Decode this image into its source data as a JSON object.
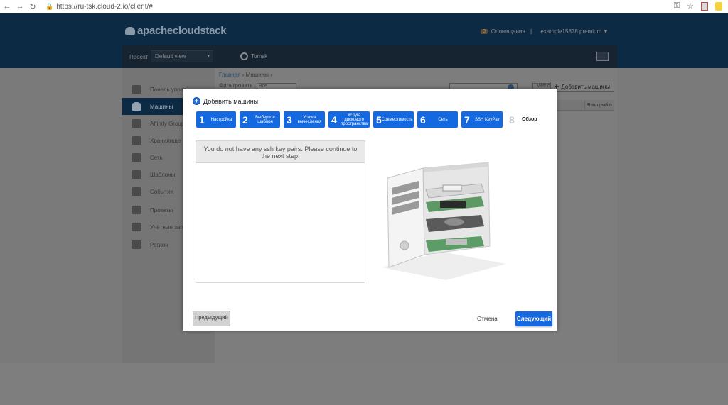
{
  "browser": {
    "back_icon": "arrow-left-icon",
    "forward_icon": "arrow-right-icon",
    "reload_icon": "reload-icon",
    "lock_icon": "lock-icon",
    "url": "https://ru-tsk.cloud-2.io/client/#",
    "key_icon": "key-icon",
    "star_icon": "star-icon"
  },
  "header": {
    "logo": "apachecloudstack",
    "notifications_count": "0",
    "notifications_label": "Оповещения",
    "separator": "|",
    "user_label": "example15878 premium",
    "chevron": "▼"
  },
  "subbar": {
    "project_label": "Проект",
    "project_value": "Default view",
    "project_chevron": "▾",
    "zone": "Tomsk"
  },
  "sidebar": {
    "items": [
      {
        "label": "Панель управ",
        "icon": "dashboard-icon"
      },
      {
        "label": "Машины",
        "icon": "cloud-icon"
      },
      {
        "label": "Affinity Groups",
        "icon": "affinity-icon"
      },
      {
        "label": "Хранилище",
        "icon": "storage-icon"
      },
      {
        "label": "Сеть",
        "icon": "network-icon"
      },
      {
        "label": "Шаблоны",
        "icon": "templates-icon"
      },
      {
        "label": "События",
        "icon": "events-icon"
      },
      {
        "label": "Проекты",
        "icon": "projects-icon"
      },
      {
        "label": "Учётные запис",
        "icon": "accounts-icon"
      },
      {
        "label": "Регион",
        "icon": "region-icon"
      }
    ]
  },
  "content": {
    "breadcrumb_home": "Главная",
    "breadcrumb_sep": "›",
    "breadcrumb_current": "Машины",
    "filter_label": "Фильтровать",
    "filter_value": "Все",
    "metrics_label": "Metrics",
    "add_vm_label": "Добавить машины",
    "quick_view_header": "Быстрый п"
  },
  "modal": {
    "title": "Добавить машины",
    "steps": [
      {
        "num": "1",
        "label": "Настройка",
        "active": true
      },
      {
        "num": "2",
        "label": "Выберите шаблон",
        "active": true
      },
      {
        "num": "3",
        "label": "Услуга вычесления",
        "active": true
      },
      {
        "num": "4",
        "label": "Услуга дискового пространства",
        "active": true
      },
      {
        "num": "5",
        "label": "Совместимость",
        "active": true
      },
      {
        "num": "6",
        "label": "Сеть",
        "active": true
      },
      {
        "num": "7",
        "label": "SSH KeyPair",
        "active": true
      },
      {
        "num": "8",
        "label": "Обзор",
        "active": false
      }
    ],
    "ssh_message": "You do not have any ssh key pairs. Please continue to the next step.",
    "prev_label": "Предыдущий",
    "cancel_label": "Отмена",
    "next_label": "Следующий"
  },
  "colors": {
    "accent": "#1469e0",
    "header_bg": "#0d2a45"
  }
}
